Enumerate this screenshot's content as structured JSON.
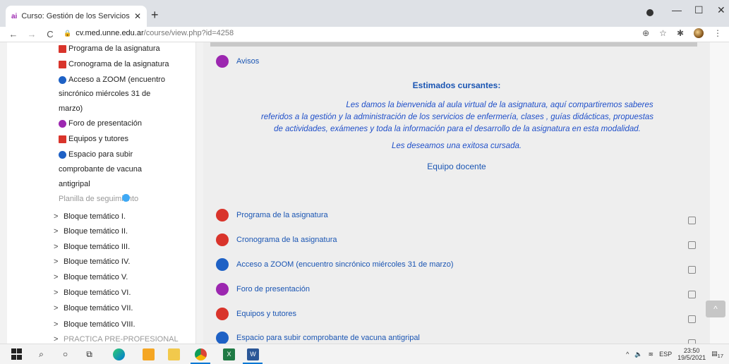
{
  "browser": {
    "tab_title": "Curso: Gestión de los Servicios d",
    "tab_favicon": "ai",
    "tab_close": "✕",
    "new_tab": "+",
    "url_host": "cv.med.unne.edu.ar",
    "url_path": "/course/view.php?id=4258",
    "back": "←",
    "forward": "→",
    "reload": "C",
    "minimize": "—",
    "maximize": "☐",
    "close": "✕"
  },
  "sidebar": {
    "activities": [
      {
        "label": "Programa de la asignatura",
        "icon": "pdf-icon"
      },
      {
        "label": "Cronograma de la asignatura",
        "icon": "pdf-icon"
      },
      {
        "label": "Acceso a ZOOM (encuentro",
        "icon": "zoom-icon"
      },
      {
        "label": "sincrónico miércoles 31 de",
        "icon": ""
      },
      {
        "label": "marzo)",
        "icon": ""
      },
      {
        "label": "Foro de presentación",
        "icon": "forum-icon"
      },
      {
        "label": "Equipos y tutores",
        "icon": "pdf-icon"
      },
      {
        "label": "Espacio para subir",
        "icon": "assignment-icon"
      },
      {
        "label": "comprobante de vacuna",
        "icon": ""
      },
      {
        "label": "antigripal",
        "icon": ""
      },
      {
        "label": "Planilla de seguimiento",
        "icon": "url-icon"
      }
    ],
    "sections": [
      "Bloque temático I.",
      "Bloque temático II.",
      "Bloque temático III.",
      "Bloque temático IV.",
      "Bloque temático V.",
      "Bloque temático VI.",
      "Bloque temático VII.",
      "Bloque temático VIII.",
      "PRACTICA PRE-PROFESIONAL"
    ],
    "chevron": ">"
  },
  "main": {
    "announcements": "Avisos",
    "welcome_title": "Estimados cursantes:",
    "welcome_line1": "Les damos la bienvenida al aula virtual de la asignatura, aquí compartiremos saberes",
    "welcome_line2": "referidos a la gestión y la administración de los servicios de enfermería, clases , guías didácticas, propuestas",
    "welcome_line3": "de actividades, exámenes y toda la información para el desarrollo de la asignatura en esta modalidad.",
    "wish": "Les deseamos una exitosa cursada.",
    "team": "Equipo docente",
    "activities": [
      {
        "label": "Programa de la asignatura",
        "icon": "pdf-icon"
      },
      {
        "label": "Cronograma de la asignatura",
        "icon": "pdf-icon"
      },
      {
        "label": "Acceso a ZOOM (encuentro sincrónico miércoles 31 de marzo)",
        "icon": "zoom-icon"
      },
      {
        "label": "Foro de presentación",
        "icon": "forum-icon"
      },
      {
        "label": "Equipos y tutores",
        "icon": "pdf-icon"
      },
      {
        "label": "Espacio para subir comprobante de vacuna antigripal",
        "icon": "assignment-icon"
      }
    ],
    "scroll_top": "^"
  },
  "taskbar": {
    "lang": "ESP",
    "time": "23:50",
    "date": "19/5/2021",
    "notif_count": "17"
  },
  "colors": {
    "link": "#1a55b3",
    "welcome_text": "#1f4fc9",
    "pdf": "#d9342b",
    "forum": "#9c27b0",
    "zoom": "#1e61c5"
  }
}
